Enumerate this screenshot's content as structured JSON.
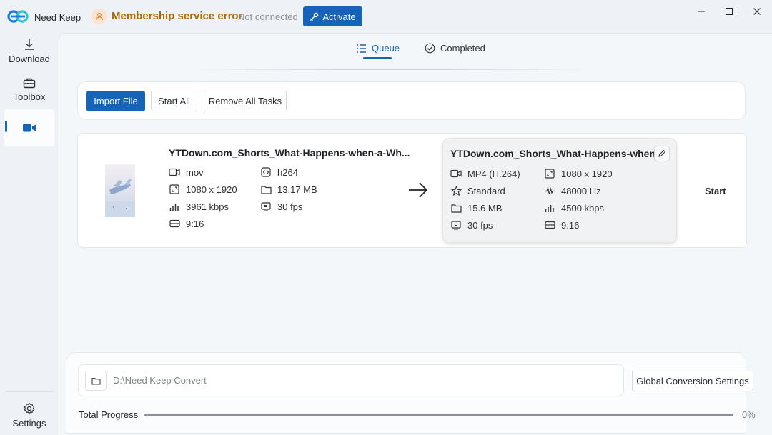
{
  "app": {
    "name": "Need Keep",
    "membership_status": "Membership service error",
    "connection_status": "Not connected",
    "activate_label": "Activate"
  },
  "sidebar": {
    "items": [
      {
        "label": "Download",
        "icon": "download-icon"
      },
      {
        "label": "Toolbox",
        "icon": "toolbox-icon"
      },
      {
        "label": "",
        "icon": "video-camera-icon",
        "active": true
      }
    ],
    "settings_label": "Settings"
  },
  "tabs": [
    {
      "label": "Queue",
      "active": true
    },
    {
      "label": "Completed",
      "active": false
    }
  ],
  "toolbar": {
    "import_label": "Import File",
    "start_all_label": "Start All",
    "remove_all_label": "Remove All Tasks"
  },
  "task": {
    "source": {
      "title": "YTDown.com_Shorts_What-Happens-when-a-Wh...",
      "format": "mov",
      "codec": "h264",
      "resolution": "1080 x 1920",
      "size": "13.17 MB",
      "bitrate": "3961 kbps",
      "fps": "30 fps",
      "aspect": "9:16"
    },
    "output": {
      "title": "YTDown.com_Shorts_What-Happens-when-...",
      "format": "MP4 (H.264)",
      "resolution": "1080 x 1920",
      "quality": "Standard",
      "sample_rate": "48000 Hz",
      "size": "15.6 MB",
      "bitrate": "4500 kbps",
      "fps": "30 fps",
      "aspect": "9:16"
    },
    "start_label": "Start"
  },
  "bottom": {
    "output_path": "D:\\Need Keep Convert",
    "global_settings_label": "Global Conversion Settings",
    "total_progress_label": "Total Progress",
    "progress_percent": "0%",
    "progress_value": 0
  },
  "colors": {
    "accent": "#1664b7",
    "membership_text": "#a86b10"
  }
}
